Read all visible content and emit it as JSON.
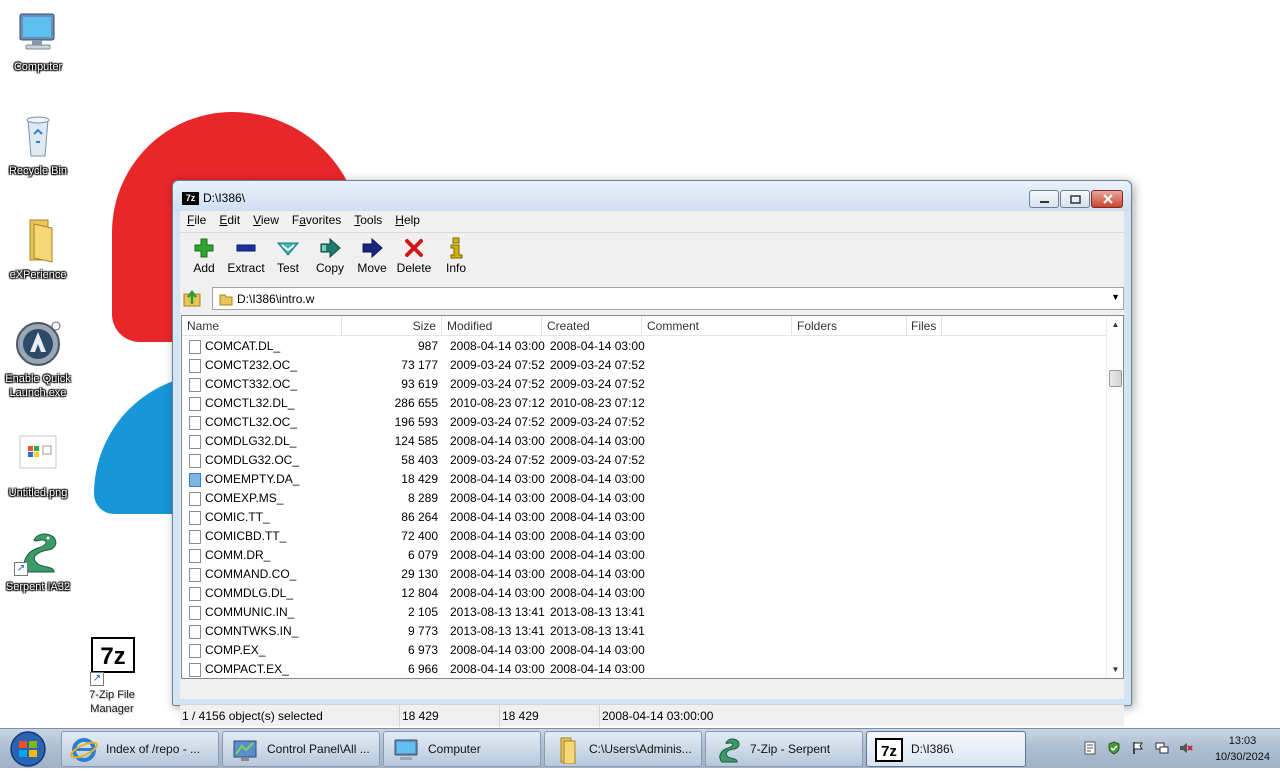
{
  "desktop": {
    "icons": [
      {
        "label": "Computer",
        "icon": "computer-icon"
      },
      {
        "label": "Recycle Bin",
        "icon": "recycle-bin-icon"
      },
      {
        "label": "eXPerience",
        "icon": "folder-icon"
      },
      {
        "label": "Enable Quick Launch.exe",
        "icon": "quick-launch-icon"
      },
      {
        "label": "Untitled.png",
        "icon": "image-file-icon"
      },
      {
        "label": "Serpent IA32",
        "icon": "serpent-icon"
      },
      {
        "label": "7-Zip File Manager",
        "icon": "7zip-icon"
      }
    ]
  },
  "window": {
    "title": "D:\\I386\\",
    "icon_text": "7z",
    "menu": [
      "File",
      "Edit",
      "View",
      "Favorites",
      "Tools",
      "Help"
    ],
    "menu_underline": [
      "F",
      "E",
      "V",
      "a",
      "T",
      "H"
    ],
    "toolbar": [
      {
        "label": "Add",
        "icon": "add-icon",
        "color": "#2fa52f"
      },
      {
        "label": "Extract",
        "icon": "extract-icon",
        "color": "#1b2f9e"
      },
      {
        "label": "Test",
        "icon": "test-icon",
        "color": "#39b7b7"
      },
      {
        "label": "Copy",
        "icon": "copy-icon",
        "color": "#1f7a6a"
      },
      {
        "label": "Move",
        "icon": "move-icon",
        "color": "#1b2580"
      },
      {
        "label": "Delete",
        "icon": "delete-icon",
        "color": "#d01818"
      },
      {
        "label": "Info",
        "icon": "info-icon",
        "color": "#d4b200"
      }
    ],
    "address": "D:\\I386\\intro.w",
    "columns": [
      "Name",
      "Size",
      "Modified",
      "Created",
      "Comment",
      "Folders",
      "Files"
    ],
    "files": [
      {
        "name": "COMCAT.DL_",
        "size": "987",
        "modified": "2008-04-14 03:00",
        "created": "2008-04-14 03:00"
      },
      {
        "name": "COMCT232.OC_",
        "size": "73 177",
        "modified": "2009-03-24 07:52",
        "created": "2009-03-24 07:52"
      },
      {
        "name": "COMCT332.OC_",
        "size": "93 619",
        "modified": "2009-03-24 07:52",
        "created": "2009-03-24 07:52"
      },
      {
        "name": "COMCTL32.DL_",
        "size": "286 655",
        "modified": "2010-08-23 07:12",
        "created": "2010-08-23 07:12"
      },
      {
        "name": "COMCTL32.OC_",
        "size": "196 593",
        "modified": "2009-03-24 07:52",
        "created": "2009-03-24 07:52"
      },
      {
        "name": "COMDLG32.DL_",
        "size": "124 585",
        "modified": "2008-04-14 03:00",
        "created": "2008-04-14 03:00"
      },
      {
        "name": "COMDLG32.OC_",
        "size": "58 403",
        "modified": "2009-03-24 07:52",
        "created": "2009-03-24 07:52"
      },
      {
        "name": "COMEMPTY.DA_",
        "size": "18 429",
        "modified": "2008-04-14 03:00",
        "created": "2008-04-14 03:00",
        "selected": true
      },
      {
        "name": "COMEXP.MS_",
        "size": "8 289",
        "modified": "2008-04-14 03:00",
        "created": "2008-04-14 03:00"
      },
      {
        "name": "COMIC.TT_",
        "size": "86 264",
        "modified": "2008-04-14 03:00",
        "created": "2008-04-14 03:00"
      },
      {
        "name": "COMICBD.TT_",
        "size": "72 400",
        "modified": "2008-04-14 03:00",
        "created": "2008-04-14 03:00"
      },
      {
        "name": "COMM.DR_",
        "size": "6 079",
        "modified": "2008-04-14 03:00",
        "created": "2008-04-14 03:00"
      },
      {
        "name": "COMMAND.CO_",
        "size": "29 130",
        "modified": "2008-04-14 03:00",
        "created": "2008-04-14 03:00"
      },
      {
        "name": "COMMDLG.DL_",
        "size": "12 804",
        "modified": "2008-04-14 03:00",
        "created": "2008-04-14 03:00"
      },
      {
        "name": "COMMUNIC.IN_",
        "size": "2 105",
        "modified": "2013-08-13 13:41",
        "created": "2013-08-13 13:41"
      },
      {
        "name": "COMNTWKS.IN_",
        "size": "9 773",
        "modified": "2013-08-13 13:41",
        "created": "2013-08-13 13:41"
      },
      {
        "name": "COMP.EX_",
        "size": "6 973",
        "modified": "2008-04-14 03:00",
        "created": "2008-04-14 03:00"
      },
      {
        "name": "COMPACT.EX_",
        "size": "6 966",
        "modified": "2008-04-14 03:00",
        "created": "2008-04-14 03:00"
      }
    ],
    "status": {
      "selection": "1 / 4156 object(s) selected",
      "size": "18 429",
      "packed": "18 429",
      "date": "2008-04-14 03:00:00"
    }
  },
  "taskbar": {
    "items": [
      {
        "label": "Index of /repo - ...",
        "icon": "internet-explorer-icon"
      },
      {
        "label": "Control Panel\\All ...",
        "icon": "control-panel-icon"
      },
      {
        "label": "Computer",
        "icon": "computer-icon"
      },
      {
        "label": "C:\\Users\\Adminis...",
        "icon": "folder-icon"
      },
      {
        "label": "7-Zip - Serpent",
        "icon": "serpent-icon"
      },
      {
        "label": "D:\\I386\\",
        "icon": "7zip-icon",
        "active": true
      }
    ],
    "clock_time": "13:03",
    "clock_date": "10/30/2024"
  }
}
